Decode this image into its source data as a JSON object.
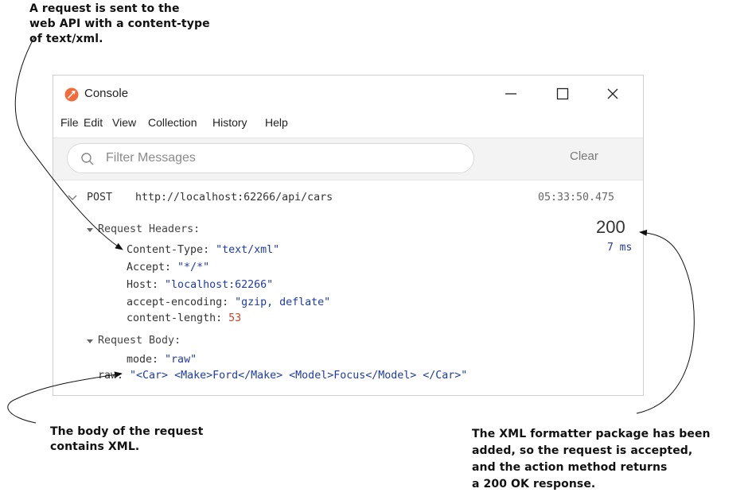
{
  "annotations": {
    "top": [
      "A request is sent to the",
      "web API with a content-type",
      "of text/xml."
    ],
    "body": [
      "The body of the request",
      "contains XML."
    ],
    "xml_formatter": [
      "The XML formatter package has been",
      "added, so the request is accepted,",
      "and the action method returns",
      "a 200 OK response."
    ]
  },
  "window": {
    "title": "Console",
    "controls": {
      "minimize": "—",
      "maximize": "☐",
      "close": "✕"
    },
    "menu": [
      "File",
      "Edit",
      "View",
      "Collection",
      "History",
      "Help"
    ]
  },
  "filter": {
    "placeholder": "Filter Messages",
    "value": "",
    "clear_label": "Clear"
  },
  "request": {
    "method": "POST",
    "url": "http://localhost:62266/api/cars",
    "timestamp": "05:33:50.475",
    "status_code": "200",
    "duration": "7 ms",
    "headers_label": "Request Headers:",
    "headers": [
      {
        "key": "Content-Type: ",
        "value": "\"text/xml\""
      },
      {
        "key": "Accept: ",
        "value": "\"*/*\""
      },
      {
        "key": "Host: ",
        "value": "\"localhost:62266\""
      },
      {
        "key": "accept-encoding: ",
        "value": "\"gzip, deflate\""
      },
      {
        "key": "content-length: ",
        "value": "53"
      }
    ],
    "body_label": "Request Body:",
    "body": [
      {
        "key": "mode: ",
        "value": "\"raw\""
      },
      {
        "key": "raw: ",
        "value": "\"<Car> <Make>Ford</Make> <Model>Focus</Model> </Car>\""
      }
    ]
  },
  "colors": {
    "accent_orange": "#f26b3a",
    "value_blue": "#1f3ba3",
    "number_red": "#c8452a"
  },
  "icons": {
    "app": "postman-icon",
    "search": "search-icon",
    "expand": "chevron-down-icon"
  }
}
